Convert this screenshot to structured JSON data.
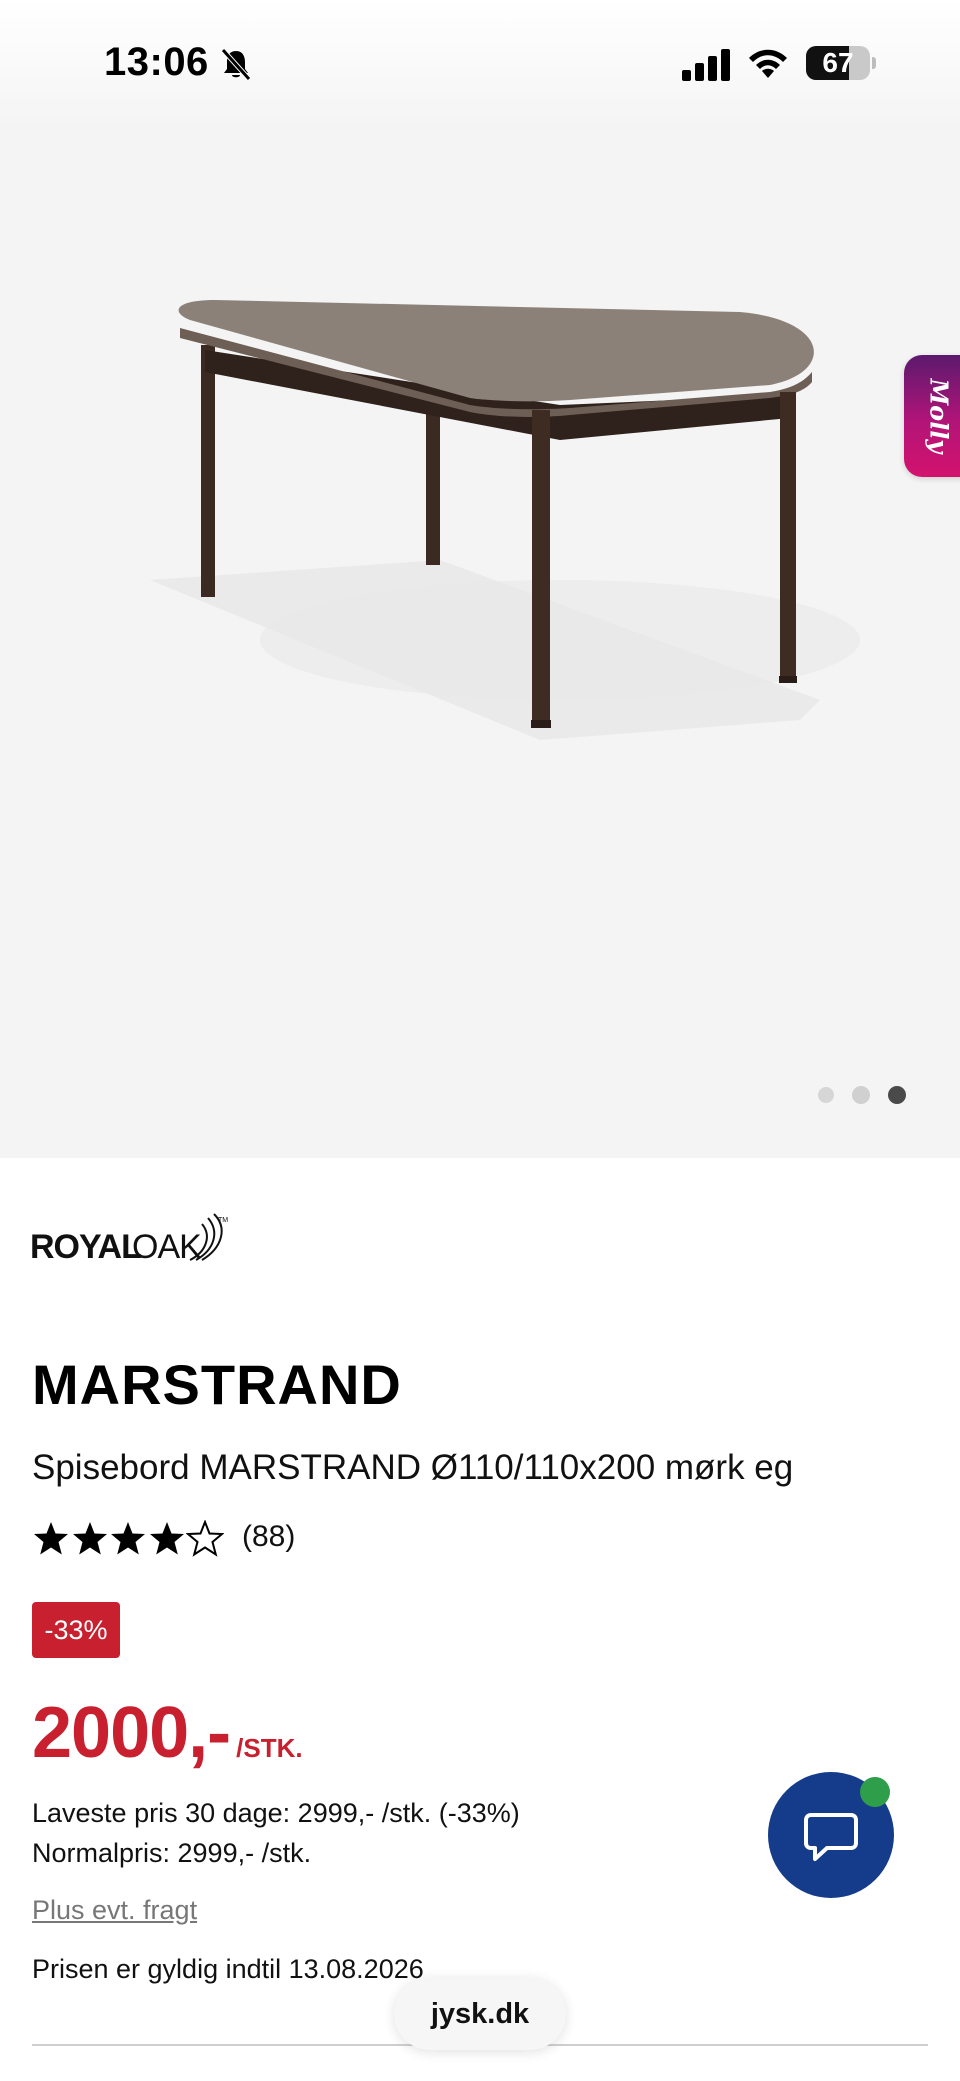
{
  "status_bar": {
    "time": "13:06",
    "battery_level": "67",
    "icons": [
      "bell-slash-icon",
      "cellular-signal-icon",
      "wifi-icon",
      "battery-icon"
    ]
  },
  "gallery": {
    "assistant_tab_label": "Molly",
    "image_count": 3,
    "active_index": 3
  },
  "product": {
    "brand_logo_text": "ROYAL OAK",
    "title": "MARSTRAND",
    "subtitle": "Spisebord MARSTRAND Ø110/110x200 mørk eg",
    "rating": 4,
    "rating_max": 5,
    "review_count": "(88)",
    "discount_badge": "-33%",
    "price": "2000,-",
    "price_unit": "/STK.",
    "lowest_price_30_days": "Laveste pris 30 dage: 2999,- /stk. (-33%)",
    "normal_price": "Normalpris: 2999,- /stk.",
    "freight_link": "Plus evt. fragt",
    "valid_until": "Prisen er gyldig indtil 13.08.2026"
  },
  "browser": {
    "url": "jysk.dk"
  },
  "colors": {
    "price_red": "#c8202f",
    "chat_blue": "#143c8a",
    "online_green": "#2e9e4a",
    "molly_magenta": "#b21478"
  }
}
